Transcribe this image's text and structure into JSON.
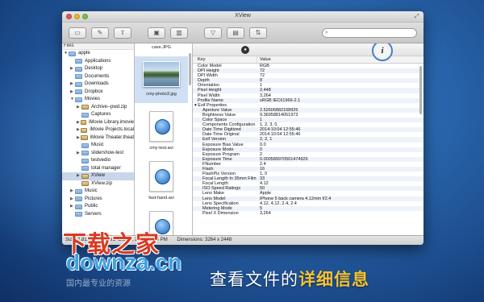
{
  "window": {
    "title": "XView"
  },
  "toolbar": {
    "buttons": [
      "folder-icon",
      "tools-icon",
      "share-icon",
      "save-icon",
      "trash-icon",
      "filter-icon",
      "view-icon",
      "sort-icon"
    ],
    "search_placeholder": ""
  },
  "files": {
    "header": "Files",
    "items": [
      {
        "label": "apple",
        "depth": 0,
        "type": "home",
        "open": true
      },
      {
        "label": "Applications",
        "depth": 1,
        "type": "folder"
      },
      {
        "label": "Desktop",
        "depth": 1,
        "type": "folder",
        "arrow": true
      },
      {
        "label": "Documents",
        "depth": 1,
        "type": "folder"
      },
      {
        "label": "Downloads",
        "depth": 1,
        "type": "folder",
        "arrow": true
      },
      {
        "label": "Dropbox",
        "depth": 1,
        "type": "folder",
        "arrow": true
      },
      {
        "label": "Movies",
        "depth": 1,
        "type": "folder",
        "open": true
      },
      {
        "label": "Archive--pwd.zip",
        "depth": 2,
        "type": "zip",
        "arrow": true
      },
      {
        "label": "Captures",
        "depth": 2,
        "type": "folder"
      },
      {
        "label": "iMovie Library.imovie",
        "depth": 2,
        "type": "zip",
        "arrow": true
      },
      {
        "label": "iMovie Projects.local",
        "depth": 2,
        "type": "zip",
        "arrow": true
      },
      {
        "label": "iMovie Theater.theat",
        "depth": 2,
        "type": "zip",
        "arrow": true
      },
      {
        "label": "Music",
        "depth": 2,
        "type": "folder"
      },
      {
        "label": "slidershow-test",
        "depth": 2,
        "type": "folder",
        "arrow": true
      },
      {
        "label": "testvedio",
        "depth": 2,
        "type": "folder"
      },
      {
        "label": "total manager",
        "depth": 2,
        "type": "folder"
      },
      {
        "label": "XView",
        "depth": 2,
        "type": "zip",
        "arrow": true,
        "selected": true
      },
      {
        "label": "XView.zip",
        "depth": 2,
        "type": "zip"
      },
      {
        "label": "Music",
        "depth": 1,
        "type": "folder",
        "arrow": true
      },
      {
        "label": "Pictures",
        "depth": 1,
        "type": "folder",
        "arrow": true
      },
      {
        "label": "Public",
        "depth": 1,
        "type": "folder",
        "arrow": true
      },
      {
        "label": "Servers",
        "depth": 1,
        "type": "folder"
      }
    ]
  },
  "thumbs": [
    {
      "label": "cave.JPG",
      "kind": "label"
    },
    {
      "label": "cmy-photo3.jpg",
      "kind": "image"
    },
    {
      "label": "cmy-test.avi",
      "kind": "video"
    },
    {
      "label": "fast-hand.avi",
      "kind": "video"
    },
    {
      "label": "",
      "kind": "video"
    }
  ],
  "props": {
    "key_header": "Key",
    "value_header": "Value",
    "info_label": "i",
    "rows": [
      {
        "k": "Color Model",
        "v": "RGB"
      },
      {
        "k": "DPI Height",
        "v": "72"
      },
      {
        "k": "DPI Width",
        "v": "72"
      },
      {
        "k": "Depth",
        "v": "8"
      },
      {
        "k": "Orientation",
        "v": "1"
      },
      {
        "k": "Pixel Height",
        "v": "2,448"
      },
      {
        "k": "Pixel Width",
        "v": "3,264"
      },
      {
        "k": "Profile Name",
        "v": "sRGB IEC61966-2.1"
      },
      {
        "k": "▾ Exif Properties",
        "v": "",
        "hdr": true
      },
      {
        "k": "Aperture Value",
        "v": "2.52606882168926",
        "sub": true
      },
      {
        "k": "Brightness Value",
        "v": "9.36958814051973",
        "sub": true
      },
      {
        "k": "Color Space",
        "v": "1",
        "sub": true
      },
      {
        "k": "Components Configuration",
        "v": "1, 2, 3, 0",
        "sub": true
      },
      {
        "k": "Date Time Digitized",
        "v": "2014:10:04 12:55:46",
        "sub": true
      },
      {
        "k": "Date Time Original",
        "v": "2014:10:04 12:55:46",
        "sub": true
      },
      {
        "k": "Exif Version",
        "v": "2, 2, 1",
        "sub": true
      },
      {
        "k": "Exposure Bias Value",
        "v": "0.0",
        "sub": true
      },
      {
        "k": "Exposure Mode",
        "v": "0",
        "sub": true
      },
      {
        "k": "Exposure Program",
        "v": "2",
        "sub": true
      },
      {
        "k": "Exposure Time",
        "v": "0.000589970501474926",
        "sub": true
      },
      {
        "k": "FNumber",
        "v": "2.4",
        "sub": true
      },
      {
        "k": "Flash",
        "v": "16",
        "sub": true
      },
      {
        "k": "FlashPix Version",
        "v": "1, 0",
        "sub": true
      },
      {
        "k": "Focal Length In 35mm Film",
        "v": "33",
        "sub": true
      },
      {
        "k": "Focal Length",
        "v": "4.12",
        "sub": true
      },
      {
        "k": "ISO Speed Ratings",
        "v": "50",
        "sub": true
      },
      {
        "k": "Lens Make",
        "v": "Apple",
        "sub": true
      },
      {
        "k": "Lens Model",
        "v": "iPhone 5 back camera 4.12mm f/2.4",
        "sub": true
      },
      {
        "k": "Lens Specification",
        "v": "4.12, 4.12, 2.4, 2.4",
        "sub": true
      },
      {
        "k": "Metering Mode",
        "v": "5",
        "sub": true
      },
      {
        "k": "Pixel X Dimension",
        "v": "3,264",
        "sub": true
      }
    ]
  },
  "status": {
    "size": "Size: 2.81MB",
    "modified": "dified: Oct 04, 2014 12:55 PM",
    "dimensions": "Dimensions: 3264 x 2448"
  },
  "watermark": {
    "brand": "下载之家",
    "domain": "downza.cn",
    "tagline": "国内最专业的资源"
  },
  "caption": {
    "prefix": "查看文件的",
    "highlight": "详细信息"
  }
}
